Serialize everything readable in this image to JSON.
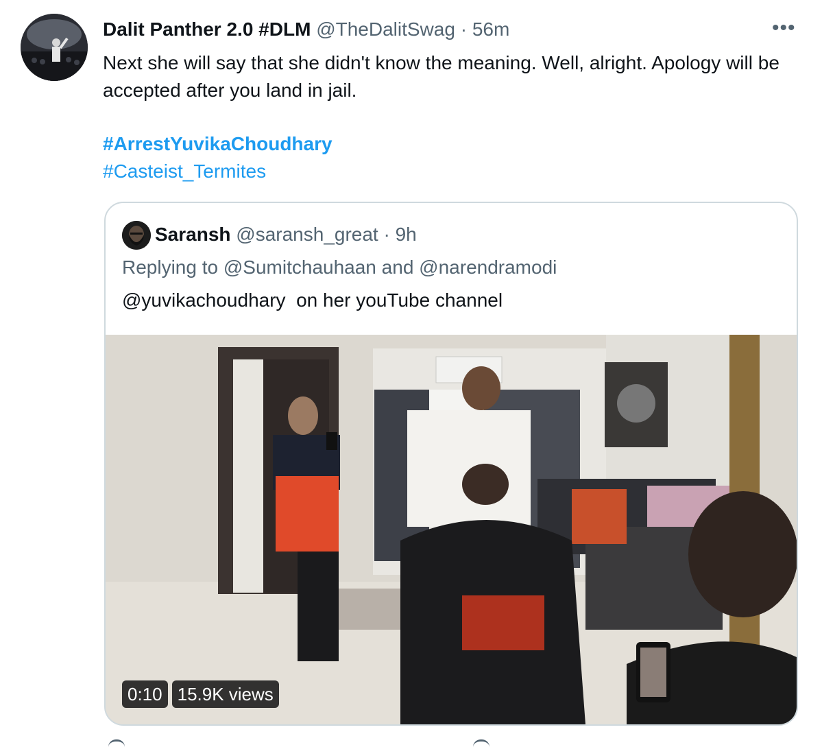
{
  "tweet": {
    "author_name": "Dalit Panther 2.0 #DLM",
    "author_handle": "@TheDalitSwag",
    "separator": "·",
    "time": "56m",
    "more_label": "•••",
    "text": "Next she will say that she didn't know the meaning. Well, alright. Apology will be accepted after you land in jail.",
    "hashtags": [
      "#ArrestYuvikaChoudhary",
      "#Casteist_Termites"
    ]
  },
  "quoted": {
    "author_name": "Saransh",
    "author_handle": "@saransh_great",
    "separator": "·",
    "time": "9h",
    "replying_prefix": "Replying to",
    "reply_mention_1": "@Sumitchauhaan",
    "reply_and": "and",
    "reply_mention_2": "@narendramodi",
    "text": "@yuvikachoudhary  on her youTube channel",
    "video": {
      "duration": "0:10",
      "views": "15.9K views"
    }
  },
  "colors": {
    "link": "#1d9bf0",
    "secondary_text": "#536471",
    "border": "#cfd9de"
  },
  "icons": [
    "more-icon",
    "play-video"
  ]
}
